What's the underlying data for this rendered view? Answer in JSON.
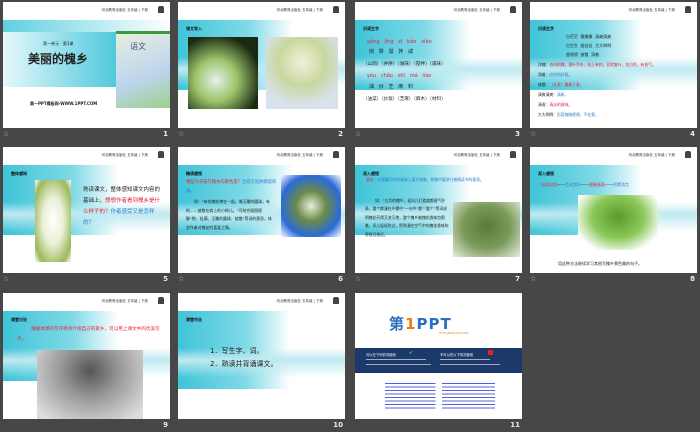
{
  "header": "河北教育出版社 五年级 | 下册",
  "slides": [
    {
      "num": "1",
      "unit": "第一单元 · 第3课",
      "title": "美丽的槐乡",
      "site": "第一PPT模板网-WWW.1PPT.COM",
      "book": "语文"
    },
    {
      "num": "2",
      "label": "课文导入"
    },
    {
      "num": "3",
      "label": "识读生字",
      "pinyin1": "gāng   jǐng   zī   bàn   xián",
      "chars1": "岗   阱   滋   拌   咸",
      "words1": "（山岗）（井阱）（滋味）（搅拌）（咸味）",
      "pinyin2": "yóu   chǎo   zhī   má   liào",
      "chars2": "油   炒   芝   麻   料",
      "words2": "（油菜）（炒饭）（芝麻）（麻木）（材料）"
    },
    {
      "num": "4",
      "label": "识读生字",
      "w1": "白茫茫  嫩嫩嫩  清爽清爽",
      "w2": "白生生  甜丝丝  大大咧咧",
      "w3": "香喷喷  披散  淌着",
      "lines": [
        {
          "k": "洋槐：",
          "v": "也叫刺槐，落叶乔木，枝上有刺，羽状复叶，花白色，有香气。"
        },
        {
          "k": "淌着：",
          "v": "应时的好饭。"
        },
        {
          "k": "披散：",
          "v": "（头发）散着下垂。"
        },
        {
          "k": "清爽清爽：",
          "v": "清新。"
        },
        {
          "k": "清香：",
          "v": "清淡的香味。"
        },
        {
          "k": "大大咧咧：",
          "v": "形容随随便便，不在意。"
        }
      ]
    },
    {
      "num": "5",
      "label": "整体感知",
      "p1": "熟读课文，整体感知课文内容的基础上，",
      "p2": "想想作者看到槐乡是什么样子的？",
      "p3": "作者感受又是怎样的？"
    },
    {
      "num": "6",
      "label": "精读感悟",
      "q": "哪些句子描写槐乡的景色美？",
      "q2": "全班交流并朗读背诵。",
      "body": "如：“有的槐花抱在一起，像玉雕的圆球，有的……披散在肩上的小辫儿。”可结合插图理解“抱、挂满、玉雕的圆球、披散”等词的意思，体会作者对槐花的喜爱之情。"
    },
    {
      "num": "7",
      "label": "深入感悟",
      "req": "要求：",
      "req_text": "在理解词句的基础上展开想象，想象中要进行感情读书的意思。",
      "body": "如：“五月的槐乡，迎风儿打旋旋都香气扑鼻，整个都漫在乡雾中”一句中“都”“整个”等词说明槐花开得又浓又艳，整个槐乡被槐花香味包围着，风儿轻轻吹过，把弥漫在空气中的槐花香味吹得很远很远。"
    },
    {
      "num": "8",
      "label": "深入感悟",
      "flow": [
        "自读自悟",
        "品读赏析",
        "想象画面",
        "积累语言"
      ],
      "caption": "用这种方法继续学习其他写槐乡景色美的句子。"
    },
    {
      "num": "9",
      "label": "课堂讨论",
      "text": "根据本课的写作特点介绍自己的家乡，可以用上课文中的优美句子。"
    },
    {
      "num": "10",
      "label": "课堂作业",
      "items": [
        "1．写生字、词。",
        "2．熟读并背诵课文。"
      ]
    },
    {
      "num": "11",
      "logo": "第1PPT",
      "url": "HTTP://WWW.1PPT.COM",
      "can": "可以在下列情况使用",
      "cannot": "不可以在以下情况使用"
    }
  ],
  "colors": {
    "accent": "#3fc4d8",
    "red": "#e8213a",
    "blue": "#2f7cc7",
    "navy": "#1b3a6b"
  }
}
